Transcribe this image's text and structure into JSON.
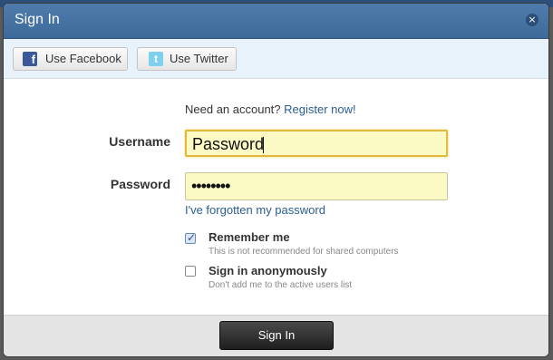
{
  "dialog": {
    "title": "Sign In",
    "close_glyph": "×"
  },
  "social": {
    "facebook_label": "Use Facebook",
    "twitter_label": "Use Twitter"
  },
  "form": {
    "need_account": "Need an account?",
    "register_link": "Register now!",
    "username_label": "Username",
    "username_value": "Password",
    "password_label": "Password",
    "password_value": "••••••••",
    "forgot_link": "I've forgotten my password",
    "remember_label": "Remember me",
    "remember_hint": "This is not recommended for shared computers",
    "remember_checked": true,
    "anon_label": "Sign in anonymously",
    "anon_hint": "Don't add me to the active users list",
    "anon_checked": false
  },
  "footer": {
    "signin_label": "Sign In"
  },
  "colors": {
    "titlebar": "#4a76a6",
    "input_bg": "#fbf9c4",
    "link": "#2a5d93"
  }
}
